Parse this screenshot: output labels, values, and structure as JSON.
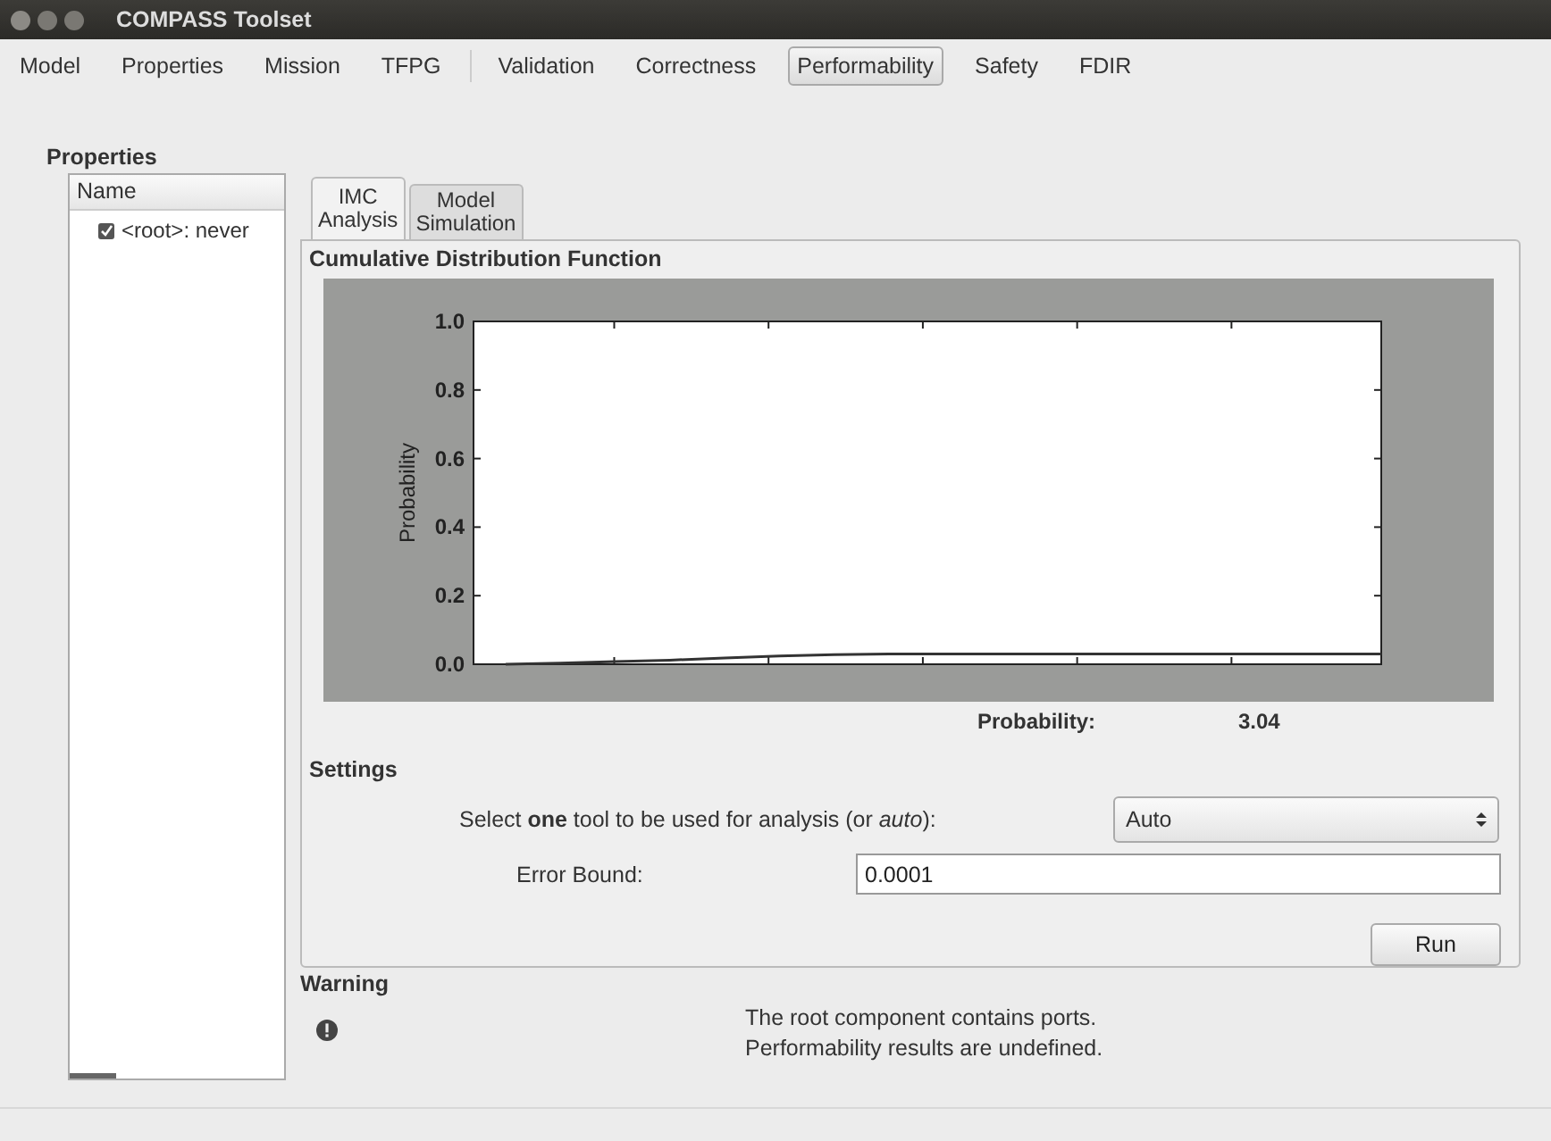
{
  "window": {
    "title": "COMPASS Toolset"
  },
  "menu_tabs": [
    {
      "label": "Model",
      "selected": false,
      "separated": false
    },
    {
      "label": "Properties",
      "selected": false,
      "separated": false
    },
    {
      "label": "Mission",
      "selected": false,
      "separated": false
    },
    {
      "label": "TFPG",
      "selected": false,
      "separated": false
    },
    {
      "label": "Validation",
      "selected": false,
      "separated": true
    },
    {
      "label": "Correctness",
      "selected": false,
      "separated": false
    },
    {
      "label": "Performability",
      "selected": true,
      "separated": false
    },
    {
      "label": "Safety",
      "selected": false,
      "separated": false
    },
    {
      "label": "FDIR",
      "selected": false,
      "separated": false
    }
  ],
  "properties": {
    "title": "Properties",
    "column": "Name",
    "items": [
      {
        "label": "<root>: never",
        "checked": true
      }
    ]
  },
  "sub_tabs": [
    {
      "label": "IMC Analysis",
      "selected": true
    },
    {
      "label": "Model Simulation",
      "selected": false
    }
  ],
  "cdf": {
    "title": "Cumulative Distribution Function",
    "chart_data": {
      "type": "line",
      "ylabel": "Probability",
      "ylim": [
        0,
        1
      ],
      "yticks": [
        {
          "value": 0,
          "label": "0.0"
        },
        {
          "value": 0.2,
          "label": "0.2"
        },
        {
          "value": 0.4,
          "label": "0.4"
        },
        {
          "value": 0.6,
          "label": "0.6"
        },
        {
          "value": 0.8,
          "label": "0.8"
        },
        {
          "value": 1,
          "label": "1.0"
        }
      ],
      "series": [
        {
          "color": "#333333",
          "values": [
            0,
            0.003,
            0.008,
            0.012,
            0.018,
            0.024,
            0.028,
            0.03,
            0.03,
            0.03,
            0.03,
            0.03,
            0.03,
            0.03,
            0.03,
            0.03,
            0.03
          ]
        }
      ]
    },
    "result_label": "Probability:",
    "result_value": "3.04"
  },
  "settings": {
    "title": "Settings",
    "tool_label": "Select **one** tool to be used for analysis (or *auto*):",
    "tool_value": "Auto",
    "bound_label": "Error Bound:",
    "bound_value": "0.0001",
    "run_button": "Run"
  },
  "warning": {
    "title": "Warning",
    "message_lines": [
      "The root component contains ports.",
      "Performability results are undefined."
    ]
  }
}
